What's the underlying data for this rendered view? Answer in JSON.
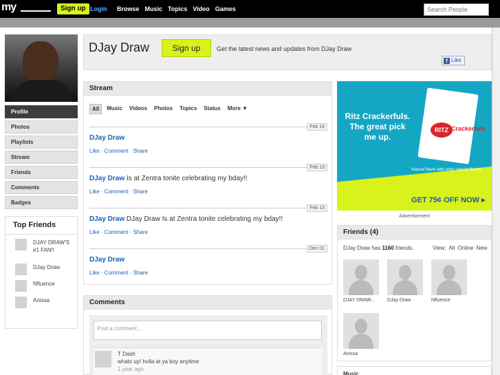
{
  "topbar": {
    "logo": "my",
    "signup": "Sign up",
    "login": "Login",
    "nav": [
      "Browse",
      "Music",
      "Topics",
      "Video",
      "Games"
    ],
    "search_placeholder": "Search People"
  },
  "sidebar": {
    "items": [
      "Profile",
      "Photos",
      "Playlists",
      "Stream",
      "Friends",
      "Comments",
      "Badges"
    ],
    "top_friends_title": "Top Friends",
    "top_friends": [
      "DJAY DRAW'S #1 FAN!!",
      "DJay Draw",
      "Nfluence",
      "Anissa"
    ]
  },
  "header": {
    "name": "DJay Draw",
    "signup": "Sign up",
    "tagline": "Get the latest news and updates from DJay Draw",
    "like": "Like"
  },
  "stream": {
    "title": "Stream",
    "tabs": [
      "All",
      "Music",
      "Videos",
      "Photos",
      "Topics",
      "Status",
      "More ▼"
    ],
    "posts": [
      {
        "date": "Feb 14",
        "author": "DJay Draw",
        "text": ""
      },
      {
        "date": "Feb 13",
        "author": "DJay Draw",
        "text": " Is at Zentra tonite celebrating my bday!!"
      },
      {
        "date": "Feb 13",
        "author": "DJay Draw",
        "text": " DJay Draw Is at Zentra tonite celebrating my bday!!"
      },
      {
        "date": "Dec 01",
        "author": "DJay Draw",
        "text": ""
      }
    ],
    "actions": {
      "like": "Like",
      "comment": "Comment",
      "share": "Share"
    }
  },
  "comments": {
    "title": "Comments",
    "placeholder": "Post a comment...",
    "items": [
      {
        "user": "T Dash",
        "text": "whats up! holla at ya boy anytime",
        "time": "1 year ago"
      }
    ]
  },
  "ad": {
    "headline": "Ritz Crackerfuls. The great pick me up.",
    "brand": "RITZ",
    "product": "Crackerfuls",
    "note": "Natural flavor with other natural flavors.",
    "offer": "GET 75¢ OFF NOW ▸",
    "label": "Advertisement"
  },
  "friends": {
    "title": "Friends (4)",
    "count_prefix": "DJay Draw has ",
    "count": "1160",
    "count_suffix": " friends.",
    "view_label": "View:",
    "view_opts": [
      "All",
      "Online",
      "New"
    ],
    "list": [
      "DJAY DRAW...",
      "DJay Draw",
      "Nfluence",
      "Anissa"
    ]
  },
  "music": {
    "title": "Music"
  }
}
